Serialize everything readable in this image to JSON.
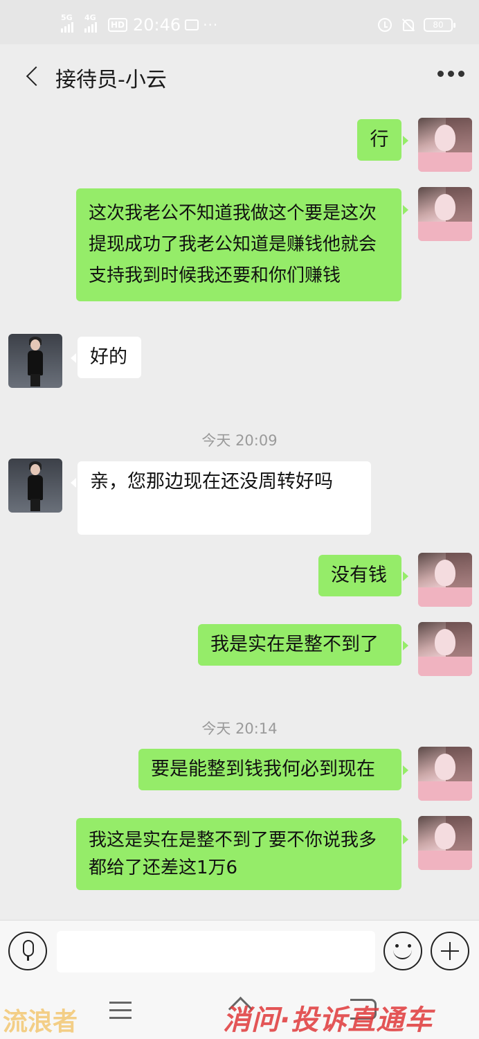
{
  "status_bar": {
    "network_1": "5G",
    "network_2": "4G",
    "hd": "HD",
    "time": "20:46",
    "more": "···",
    "battery": "80"
  },
  "header": {
    "back_icon": "chevron-left-icon",
    "title": "接待员-小云",
    "more_icon": "more-icon"
  },
  "messages": [
    {
      "side": "out",
      "text": "行"
    },
    {
      "side": "out",
      "text": "这次我老公不知道我做这个要是这次提现成功了我老公知道是赚钱他就会支持我到时候我还要和你们赚钱"
    },
    {
      "side": "in",
      "text": "好的"
    },
    {
      "type": "time",
      "text": "今天 20:09"
    },
    {
      "side": "in",
      "text": "亲，您那边现在还没周转好吗"
    },
    {
      "side": "out",
      "text": "没有钱"
    },
    {
      "side": "out",
      "text": "我是实在是整不到了"
    },
    {
      "type": "time",
      "text": "今天 20:14"
    },
    {
      "side": "out",
      "text": "要是能整到钱我何必到现在"
    },
    {
      "side": "out",
      "text": "我这是实在是整不到了要不你说我多都给了还差这1万6"
    }
  ],
  "input_bar": {
    "voice_icon": "microphone-icon",
    "emoji_icon": "emoji-icon",
    "plus_icon": "plus-icon"
  },
  "watermarks": {
    "left": "流浪者",
    "right": "消问·投诉直通车"
  },
  "colors": {
    "out_bubble": "#95ec69",
    "in_bubble": "#ffffff",
    "background": "#ededed"
  }
}
